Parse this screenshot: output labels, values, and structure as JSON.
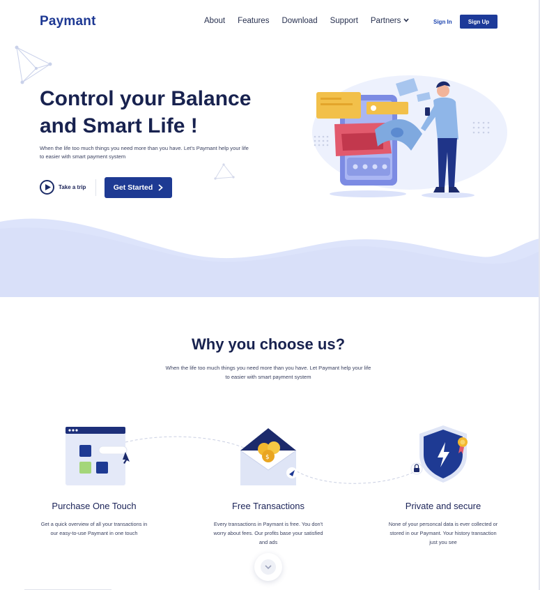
{
  "brand": {
    "logo": "Paymant",
    "primary": "#1e3a93",
    "accent": "#1d45b0",
    "dark_text": "#18224f",
    "wave": "#dde4fb"
  },
  "nav": {
    "items": [
      "About",
      "Features",
      "Download",
      "Support",
      "Partners"
    ],
    "partners_icon": "chevron-down-icon",
    "signin": "Sign In",
    "signup": "Sign Up"
  },
  "hero": {
    "title": "Control your Balance and Smart Life !",
    "subtitle": "When the life too much things you need more than you have. Let's Paymant help your life to easier with smart payment system",
    "trip_label": "Take a trip",
    "cta_label": "Get Started"
  },
  "why": {
    "title": "Why you choose us?",
    "subtitle": "When the life too much things you need more than you have. Let Paymant help your life to easier with smart payment system",
    "features": [
      {
        "title": "Purchase One Touch",
        "text": "Get a quick overview of all your transactions in our easy-to-use Paymant in one touch",
        "icon": "dashboard-window-icon"
      },
      {
        "title": "Free Transactions",
        "text": "Every transactions in Paymant is free. You don't worry about fees. Our profits base your satisfied and ads",
        "icon": "envelope-coins-icon"
      },
      {
        "title": "Private and secure",
        "text": "None of your personcal data is ever collected or stored in our Paymant. Your history transaction just you see",
        "icon": "shield-lightning-icon"
      }
    ]
  }
}
